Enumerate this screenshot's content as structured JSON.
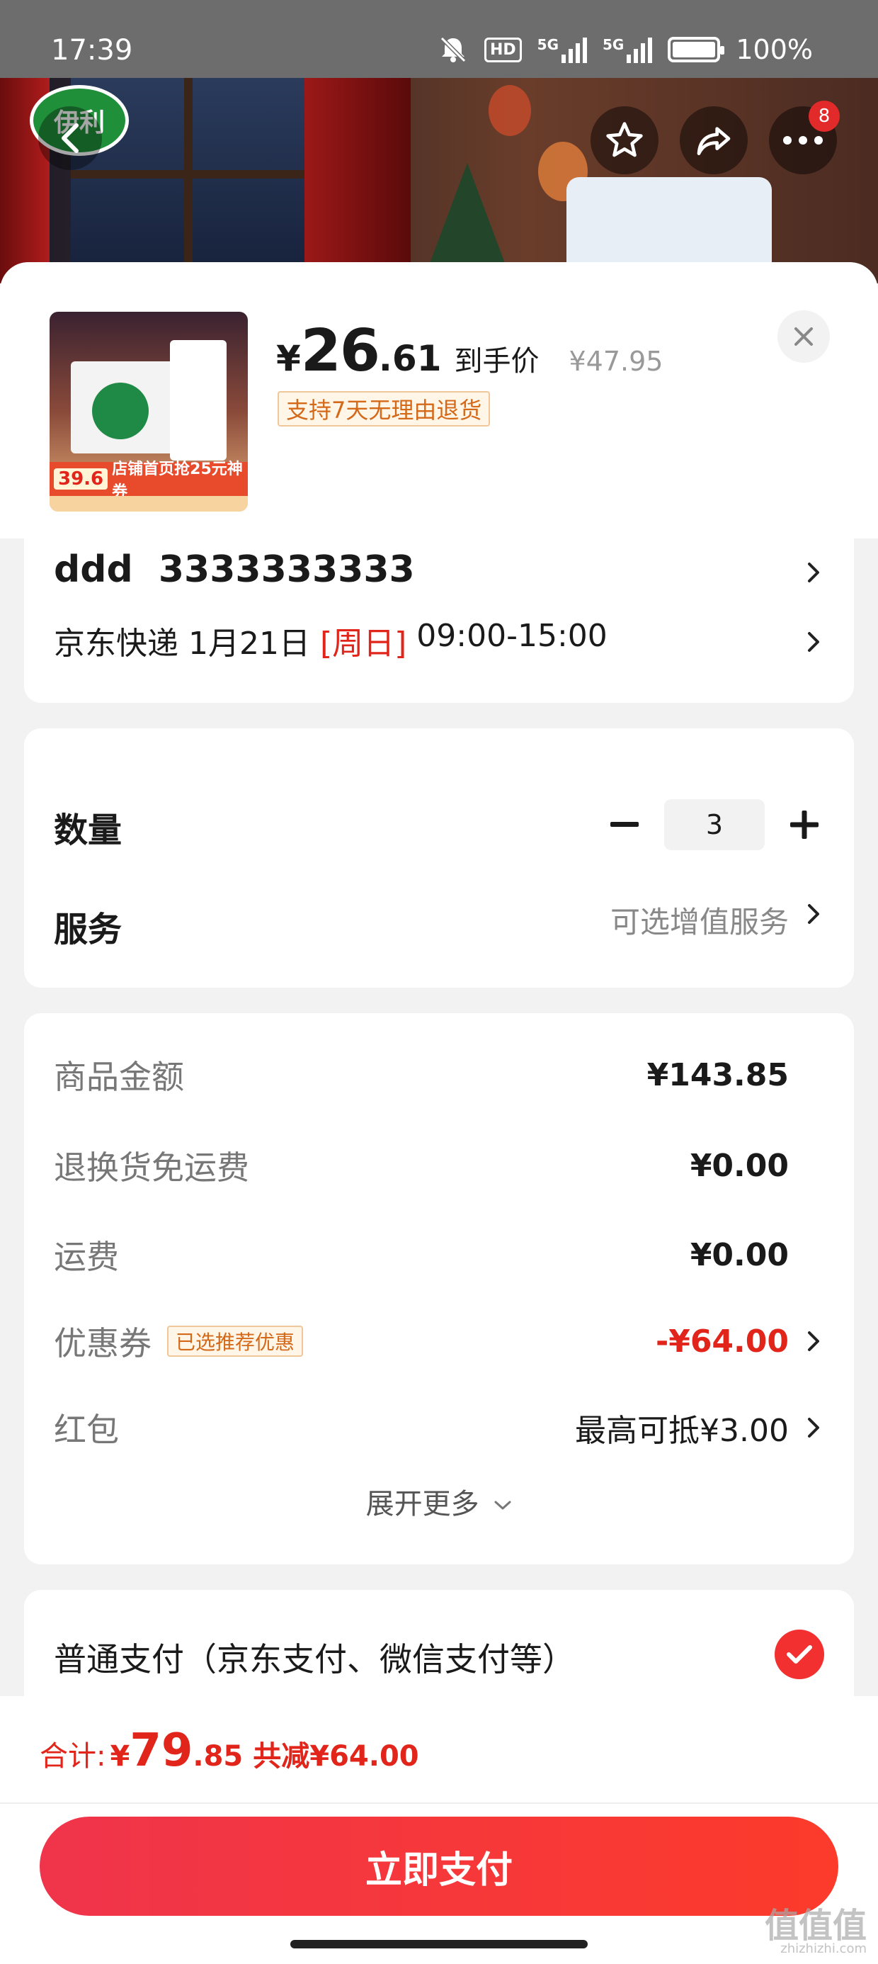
{
  "status_bar": {
    "time": "17:39",
    "hd_label": "HD",
    "net1": "5G",
    "net2": "5G",
    "battery": "100%"
  },
  "header": {
    "brand_text": "伊利",
    "cart_badge": "8"
  },
  "product": {
    "price_symbol": "¥",
    "price_int": "26",
    "price_dec": ".61",
    "price_tag": "到手价",
    "original_price": "¥47.95",
    "return_tag": "支持7天无理由退货",
    "thumb_price": "39.6",
    "thumb_promo": "店铺首页抢25元神券"
  },
  "address": {
    "name_phone": "ddd  3333333333",
    "ship_prefix": "京东快递 1月21日 ",
    "ship_day": "[周日]",
    "ship_time": " 09:00-15:00"
  },
  "quantity": {
    "label": "数量",
    "value": "3",
    "service_label": "服务",
    "service_value": "可选增值服务"
  },
  "fees": {
    "goods_label": "商品金额",
    "goods_value": "¥143.85",
    "return_label": "退换货免运费",
    "return_value": "¥0.00",
    "shipping_label": "运费",
    "shipping_value": "¥0.00",
    "coupon_label": "优惠券",
    "coupon_tag": "已选推荐优惠",
    "coupon_value": "-¥64.00",
    "redpacket_label": "红包",
    "redpacket_value": "最高可抵¥3.00",
    "expand_label": "展开更多"
  },
  "payment": {
    "method_label": "普通支付（京东支付、微信支付等）"
  },
  "bottom": {
    "total_label": "合计:",
    "total_symbol": "¥",
    "total_int": "79",
    "total_dec": ".85",
    "saved": "共减¥64.00",
    "pay_button": "立即支付",
    "watermark": "值值值",
    "watermark_url": "zhizhizhi.com"
  },
  "colors": {
    "accent_red": "#e1251b",
    "button_gradient_start": "#f0344b",
    "button_gradient_end": "#fc3b2b",
    "tag_orange": "#d4691a"
  },
  "icons": [
    "back-icon",
    "star-icon",
    "share-icon",
    "more-icon",
    "close-icon",
    "chevron-right-icon",
    "minus-icon",
    "plus-icon",
    "check-icon",
    "chevron-down-icon",
    "bell-off-icon"
  ]
}
